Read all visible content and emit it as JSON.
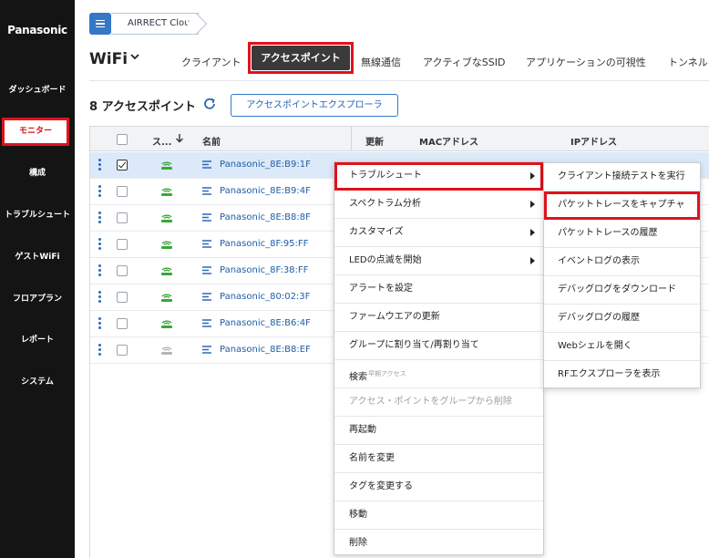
{
  "sidebar": {
    "logo": "Panasonic",
    "items": [
      {
        "label": "ダッシュボード"
      },
      {
        "label": "モニター"
      },
      {
        "label": "構成"
      },
      {
        "label": "トラブルシュート"
      },
      {
        "label": "ゲストWiFi"
      },
      {
        "label": "フロアプラン"
      },
      {
        "label": "レポート"
      },
      {
        "label": "システム"
      }
    ],
    "active_index": 1
  },
  "breadcrumb": {
    "label": "AIRRECT Cloud"
  },
  "header": {
    "title": "WiFi",
    "tabs": [
      {
        "label": "クライアント"
      },
      {
        "label": "アクセスポイント"
      },
      {
        "label": "無線通信"
      },
      {
        "label": "アクティブなSSID"
      },
      {
        "label": "アプリケーションの可視性"
      },
      {
        "label": "トンネル"
      }
    ],
    "active_tab": 1
  },
  "toolbar": {
    "count_title": "8 アクセスポイント",
    "explorer_button": "アクセスポイントエクスプローラ"
  },
  "table": {
    "columns": {
      "status": "ス...",
      "name": "名前",
      "update": "更新",
      "mac": "MACアドレス",
      "ip": "IPアドレス"
    },
    "rows": [
      {
        "name": "Panasonic_8E:B9:1F",
        "checked": true,
        "online": true
      },
      {
        "name": "Panasonic_8E:B9:4F",
        "checked": false,
        "online": true
      },
      {
        "name": "Panasonic_8E:B8:8F",
        "checked": false,
        "online": true
      },
      {
        "name": "Panasonic_8F:95:FF",
        "checked": false,
        "online": true
      },
      {
        "name": "Panasonic_8F:38:FF",
        "checked": false,
        "online": true
      },
      {
        "name": "Panasonic_80:02:3F",
        "checked": false,
        "online": true
      },
      {
        "name": "Panasonic_8E:B6:4F",
        "checked": false,
        "online": true
      },
      {
        "name": "Panasonic_8E:B8:EF",
        "checked": false,
        "online": false
      }
    ]
  },
  "context_menu": {
    "items": [
      {
        "label": "トラブルシュート",
        "submenu": true,
        "highlighted": true
      },
      {
        "label": "スペクトラム分析",
        "submenu": true
      },
      {
        "label": "カスタマイズ",
        "submenu": true
      },
      {
        "label": "LEDの点滅を開始",
        "submenu": true
      },
      {
        "label": "アラートを設定"
      },
      {
        "label": "ファームウエアの更新"
      },
      {
        "label": "グループに割り当て/再割り当て"
      },
      {
        "label": "検索",
        "sup": "早期アクセス"
      },
      {
        "label": "アクセス・ポイントをグループから削除",
        "disabled": true
      },
      {
        "label": "再起動"
      },
      {
        "label": "名前を変更"
      },
      {
        "label": "タグを変更する"
      },
      {
        "label": "移動"
      },
      {
        "label": "削除"
      }
    ]
  },
  "submenu": {
    "items": [
      {
        "label": "クライアント接続テストを実行"
      },
      {
        "label": "パケットトレースをキャプチャ",
        "highlighted": true
      },
      {
        "label": "パケットトレースの履歴"
      },
      {
        "label": "イベントログの表示"
      },
      {
        "label": "デバッグログをダウンロード"
      },
      {
        "label": "デバッグログの履歴"
      },
      {
        "label": "Webシェルを開く"
      },
      {
        "label": "RFエクスプローラを表示"
      }
    ]
  },
  "colors": {
    "sidebar_bg": "#141414",
    "accent_blue": "#3478c6",
    "highlight_red": "#e0121c",
    "online_green": "#3aa63a",
    "offline_gray": "#b5b5b5"
  }
}
